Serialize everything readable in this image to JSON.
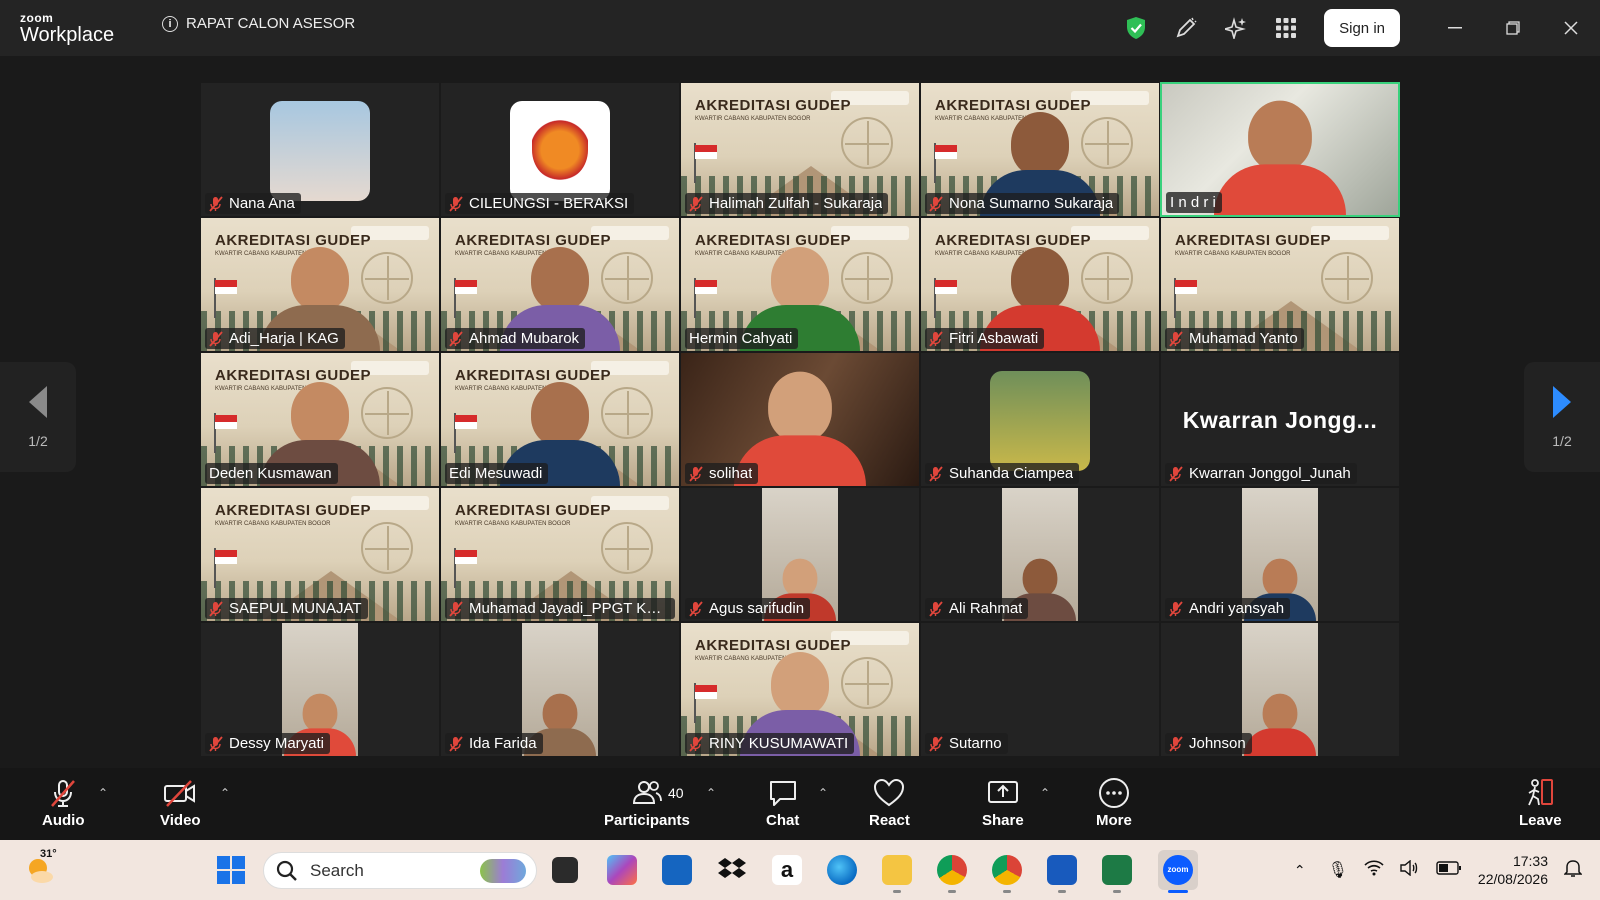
{
  "app": {
    "brand_top": "zoom",
    "brand_bottom": "Workplace",
    "meeting_title": "RAPAT CALON ASESOR",
    "sign_in": "Sign in"
  },
  "background_banner": {
    "title": "AKREDITASI GUDEP",
    "subtitle": "KWARTIR CABANG KABUPATEN BOGOR"
  },
  "participants": [
    {
      "name": "Nana Ana",
      "muted": true,
      "kind": "avatar-photo"
    },
    {
      "name": "CILEUNGSI - BERAKSI",
      "muted": true,
      "kind": "avatar-logo"
    },
    {
      "name": "Halimah Zulfah - Sukaraja",
      "muted": true,
      "kind": "banner"
    },
    {
      "name": "Nona Sumarno Sukaraja",
      "muted": true,
      "kind": "banner-person"
    },
    {
      "name": "I n d r i",
      "muted": false,
      "kind": "video",
      "active": true
    },
    {
      "name": "Adi_Harja | KAG",
      "muted": true,
      "kind": "banner-person"
    },
    {
      "name": "Ahmad Mubarok",
      "muted": true,
      "kind": "banner-person"
    },
    {
      "name": "Hermin Cahyati",
      "muted": false,
      "kind": "banner-person"
    },
    {
      "name": "Fitri Asbawati",
      "muted": true,
      "kind": "banner-person"
    },
    {
      "name": "Muhamad Yanto",
      "muted": true,
      "kind": "banner"
    },
    {
      "name": "Deden Kusmawan",
      "muted": false,
      "kind": "banner-person"
    },
    {
      "name": "Edi Mesuwadi",
      "muted": false,
      "kind": "banner-person"
    },
    {
      "name": "solihat",
      "muted": true,
      "kind": "video"
    },
    {
      "name": "Suhanda Ciampea",
      "muted": true,
      "kind": "avatar-photo"
    },
    {
      "name": "Kwarran Jonggol_Junah",
      "muted": true,
      "kind": "name-only",
      "display": "Kwarran  Jongg..."
    },
    {
      "name": "SAEPUL MUNAJAT",
      "muted": true,
      "kind": "banner"
    },
    {
      "name": "Muhamad Jayadi_PPGT Kwa...",
      "muted": true,
      "kind": "banner"
    },
    {
      "name": "Agus sarifudin",
      "muted": true,
      "kind": "portrait"
    },
    {
      "name": "Ali Rahmat",
      "muted": true,
      "kind": "portrait"
    },
    {
      "name": "Andri yansyah",
      "muted": true,
      "kind": "portrait"
    },
    {
      "name": "Dessy Maryati",
      "muted": true,
      "kind": "portrait"
    },
    {
      "name": "Ida Farida",
      "muted": true,
      "kind": "portrait"
    },
    {
      "name": "RINY KUSUMAWATI",
      "muted": true,
      "kind": "banner-person"
    },
    {
      "name": "Sutarno",
      "muted": true,
      "kind": "empty"
    },
    {
      "name": "Johnson",
      "muted": true,
      "kind": "portrait"
    }
  ],
  "pager": {
    "left": "1/2",
    "right": "1/2"
  },
  "toolbar": {
    "audio": "Audio",
    "video": "Video",
    "participants": "Participants",
    "participants_count": "40",
    "chat": "Chat",
    "react": "React",
    "share": "Share",
    "more": "More",
    "leave": "Leave"
  },
  "taskbar": {
    "temperature": "31°",
    "search_placeholder": "Search",
    "time": "17:33",
    "date": "22/08/2026"
  },
  "colors": {
    "active_speaker": "#39d17c",
    "mute_red": "#e0463c",
    "pager_arrow": "#2d8cff"
  }
}
